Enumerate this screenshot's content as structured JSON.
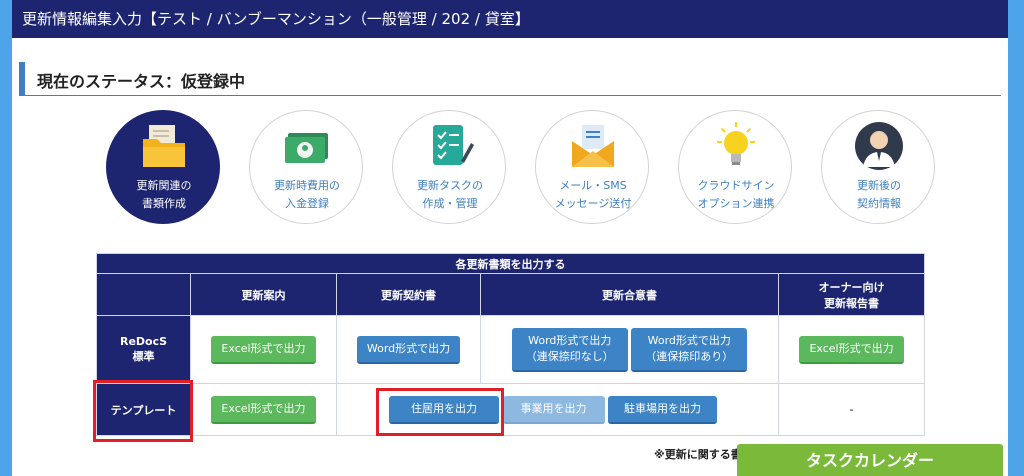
{
  "window": {
    "title": "更新情報編集入力【テスト / バンブーマンション（一般管理 / 202 / 貸室】"
  },
  "status": {
    "label": "現在のステータス：仮登録中"
  },
  "steps": [
    {
      "line1": "更新関連の",
      "line2": "書類作成",
      "icon": "folder-icon",
      "active": true
    },
    {
      "line1": "更新時費用の",
      "line2": "入金登録",
      "icon": "money-icon",
      "active": false
    },
    {
      "line1": "更新タスクの",
      "line2": "作成・管理",
      "icon": "checklist-icon",
      "active": false
    },
    {
      "line1": "メール・SMS",
      "line2": "メッセージ送付",
      "icon": "mail-icon",
      "active": false
    },
    {
      "line1": "クラウドサイン",
      "line2": "オプション連携",
      "icon": "lightbulb-icon",
      "active": false
    },
    {
      "line1": "更新後の",
      "line2": "契約情報",
      "icon": "person-icon",
      "active": false
    }
  ],
  "table": {
    "title": "各更新書類を出力する",
    "columns": [
      "更新案内",
      "更新契約書",
      "更新合意書",
      "オーナー向け",
      "更新報告書"
    ],
    "rows": [
      {
        "head": "ReDocS",
        "head2": "標準",
        "guide_btn": "Excel形式で出力",
        "contract_btn": "Word形式で出力",
        "agree_btn1_l1": "Word形式で出力",
        "agree_btn1_l2": "（連保捺印なし）",
        "agree_btn2_l1": "Word形式で出力",
        "agree_btn2_l2": "（連保捺印あり）",
        "owner_btn": "Excel形式で出力"
      },
      {
        "head": "テンプレート",
        "guide_btn": "Excel形式で出力",
        "residential_btn": "住居用を出力",
        "business_btn": "事業用を出力",
        "parking_btn": "駐車場用を出力",
        "owner_value": "-"
      }
    ]
  },
  "note": "※更新に関する書",
  "task_calendar": "タスクカレンダー",
  "colors": {
    "navy": "#1d2470",
    "accent_blue": "#3d84c6",
    "green": "#5cb85c",
    "highlight_red": "#e01f26",
    "task_green": "#7bb93a"
  }
}
